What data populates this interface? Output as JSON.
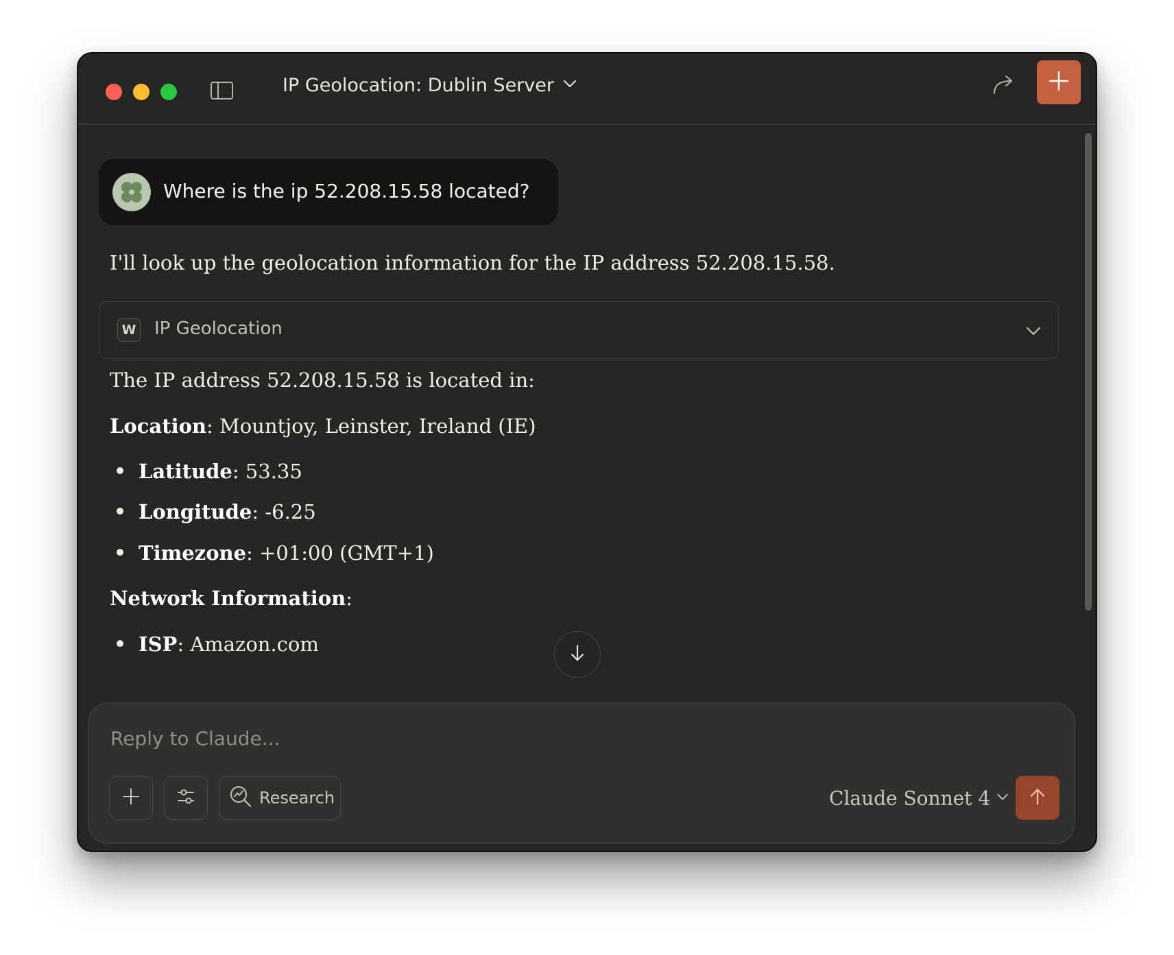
{
  "window": {
    "title": "IP Geolocation: Dublin Server",
    "accent_color": "#c6613f"
  },
  "user_message": {
    "text": "Where is the ip 52.208.15.58 located?"
  },
  "assistant": {
    "intro": "I'll look up the geolocation information for the IP address 52.208.15.58.",
    "tool": {
      "badge": "W",
      "name": "IP Geolocation",
      "icon": "chevron-down-icon"
    },
    "summary": "The IP address 52.208.15.58 is located in:",
    "location": {
      "label": "Location",
      "value": ": Mountjoy, Leinster, Ireland (IE)"
    },
    "location_details": [
      {
        "label": "Latitude",
        "value": ": 53.35"
      },
      {
        "label": "Longitude",
        "value": ": -6.25"
      },
      {
        "label": "Timezone",
        "value": ": +01:00 (GMT+1)"
      }
    ],
    "network_heading": {
      "label": "Network Information",
      "suffix": ":"
    },
    "network_details": [
      {
        "label": "ISP",
        "value": ": Amazon.com"
      }
    ]
  },
  "composer": {
    "placeholder": "Reply to Claude...",
    "research_label": "Research",
    "model_name": "Claude Sonnet 4",
    "send_color": "#97452b"
  }
}
